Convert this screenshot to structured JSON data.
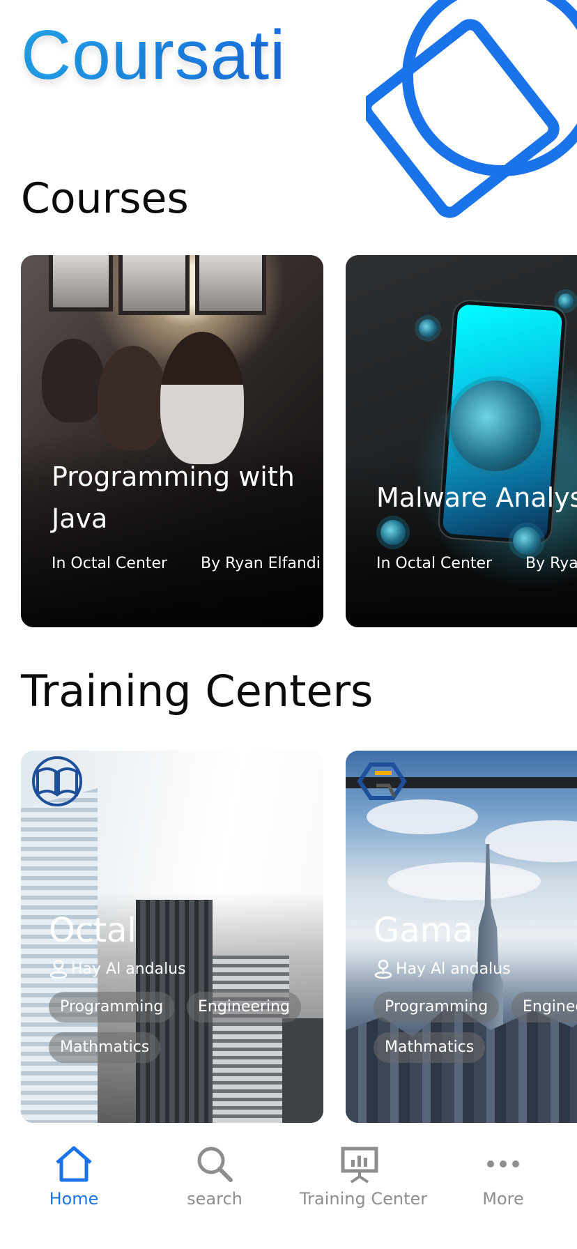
{
  "app": {
    "title": "Coursati"
  },
  "colors": {
    "accent": "#1a73e8",
    "brand_gradient_start": "#23a6f0",
    "nav_inactive": "#8e8e8e"
  },
  "sections": {
    "courses": "Courses",
    "training_centers": "Training Centers"
  },
  "courses": [
    {
      "title_line1": "Programming with",
      "title_line2": "Java",
      "center": "In Octal Center",
      "author": "By Ryan Elfandi"
    },
    {
      "title_line1": "Malware Analysis",
      "title_line2": "",
      "center": "In Octal Center",
      "author": "By Ryan Elfandi"
    }
  ],
  "centers": [
    {
      "name": "Octal",
      "location": "Hay Al andalus",
      "tags": [
        "Programming",
        "Engineering",
        "Mathmatics"
      ],
      "logo_icon": "book-globe-icon"
    },
    {
      "name": "Gama",
      "location": "Hay Al andalus",
      "tags": [
        "Programming",
        "Engineering",
        "Mathmatics"
      ],
      "logo_icon": "hexagon-g-icon"
    }
  ],
  "nav": {
    "items": [
      {
        "label": "Home",
        "icon": "home-icon",
        "active": true
      },
      {
        "label": "search",
        "icon": "search-icon",
        "active": false
      },
      {
        "label": "Training Center",
        "icon": "presentation-board-icon",
        "active": false
      },
      {
        "label": "More",
        "icon": "more-dots-icon",
        "active": false
      }
    ]
  }
}
